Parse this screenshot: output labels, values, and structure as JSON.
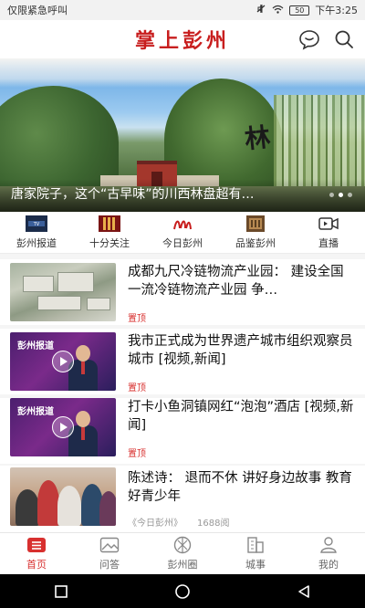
{
  "status_bar": {
    "left_text": "仅限紧急呼叫",
    "battery": "50",
    "time": "下午3:25"
  },
  "header": {
    "title": "掌上彭州"
  },
  "banner": {
    "caption": "唐家院子，这个“古早味”的川西林盘超有…",
    "calligraphy": "林"
  },
  "channels": [
    {
      "label": "彭州报道"
    },
    {
      "label": "十分关注"
    },
    {
      "label": "今日彭州"
    },
    {
      "label": "品鉴彭州"
    },
    {
      "label": "直播"
    }
  ],
  "news": [
    {
      "title": "成都九尺冷链物流产业园：  建设全国一流冷链物流产业园 争…",
      "tag": "置顶"
    },
    {
      "title": "我市正式成为世界遗产城市组织观察员城市 [视频,新闻]",
      "tag": "置顶",
      "thumb_logo": "彭州报道"
    },
    {
      "title": "打卡小鱼洞镇网红“泡泡”酒店 [视频,新闻]",
      "tag": "置顶",
      "thumb_logo": "彭州报道"
    },
    {
      "title": "陈述诗：  退而不休  讲好身边故事  教育好青少年",
      "source": "《今日彭州》",
      "views": "1688阅"
    }
  ],
  "tabbar": [
    {
      "label": "首页",
      "active": true
    },
    {
      "label": "问答"
    },
    {
      "label": "彭州圈"
    },
    {
      "label": "城事"
    },
    {
      "label": "我的"
    }
  ],
  "colors": {
    "brand_red": "#c81e1e",
    "accent_red": "#d8302f"
  }
}
